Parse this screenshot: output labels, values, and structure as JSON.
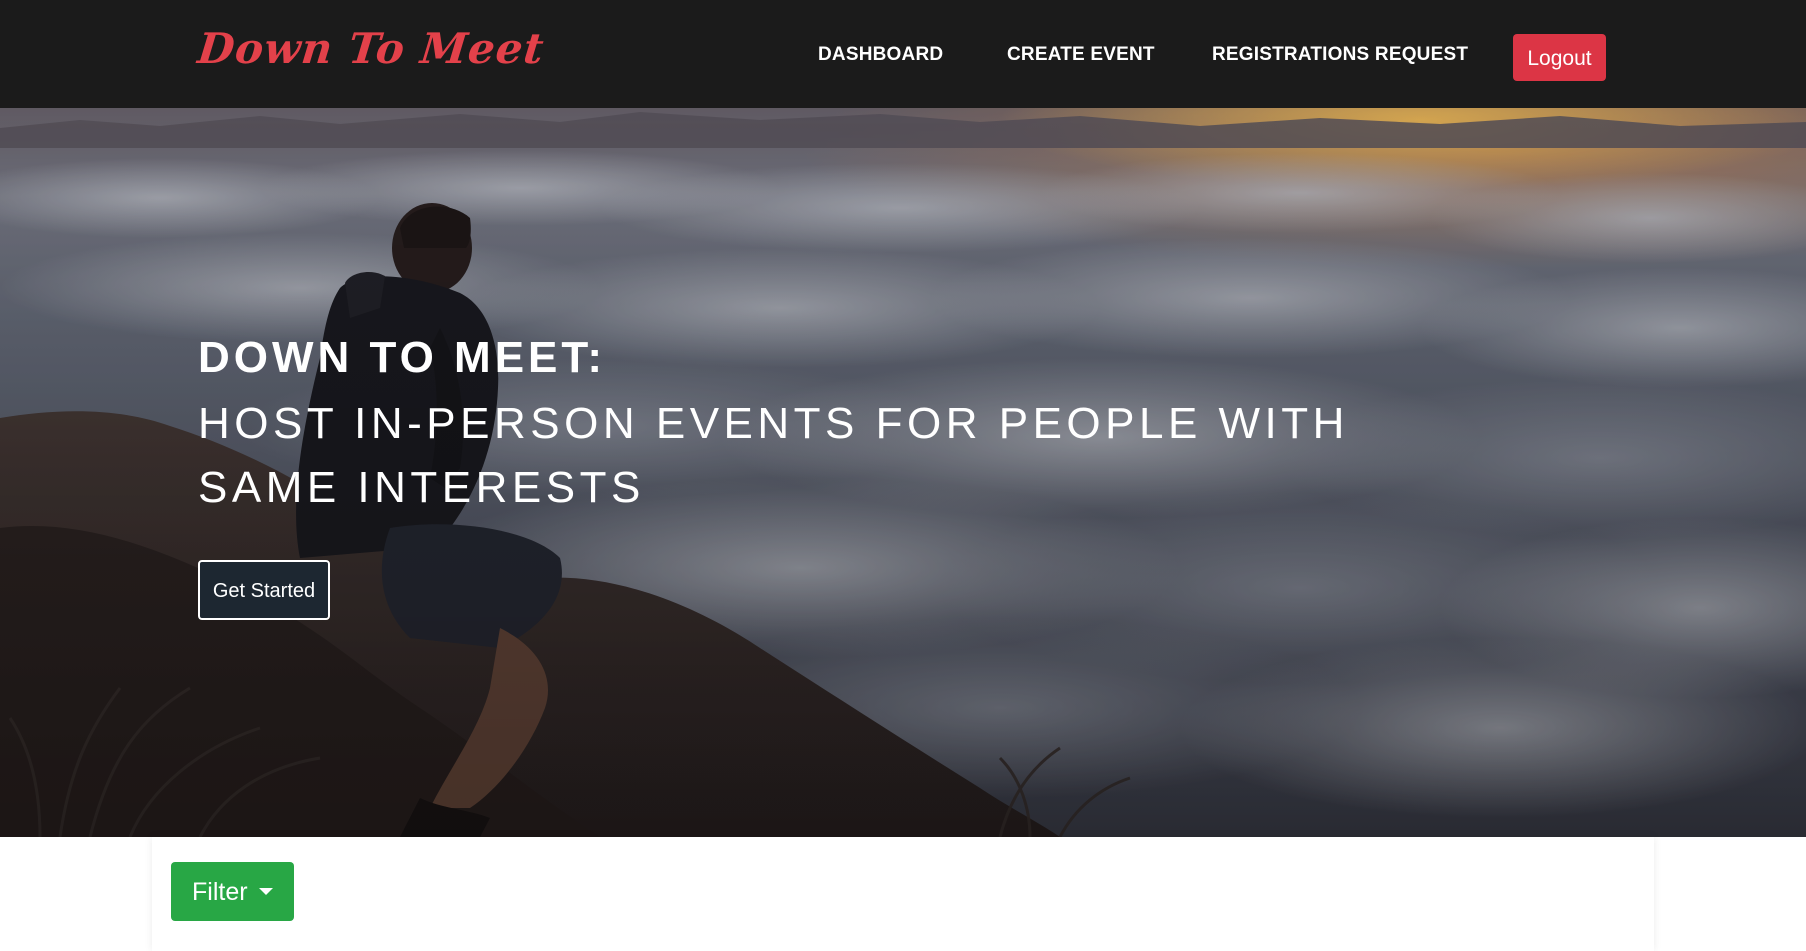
{
  "navbar": {
    "brand": "Down To Meet",
    "links": [
      "DASHBOARD",
      "CREATE EVENT",
      "REGISTRATIONS REQUEST"
    ],
    "logout_label": "Logout"
  },
  "hero": {
    "title": "DOWN TO MEET:",
    "subtitle": "HOST IN-PERSON EVENTS FOR PEOPLE WITH SAME INTERESTS",
    "cta_label": "Get Started"
  },
  "content": {
    "filter_label": "Filter",
    "filter_icon": "caret-down-icon"
  },
  "colors": {
    "navbar_bg": "#1b1b1b",
    "brand": "#e3414a",
    "logout": "#dc3545",
    "filter": "#28a745",
    "cta_bg": "#1d2731"
  }
}
